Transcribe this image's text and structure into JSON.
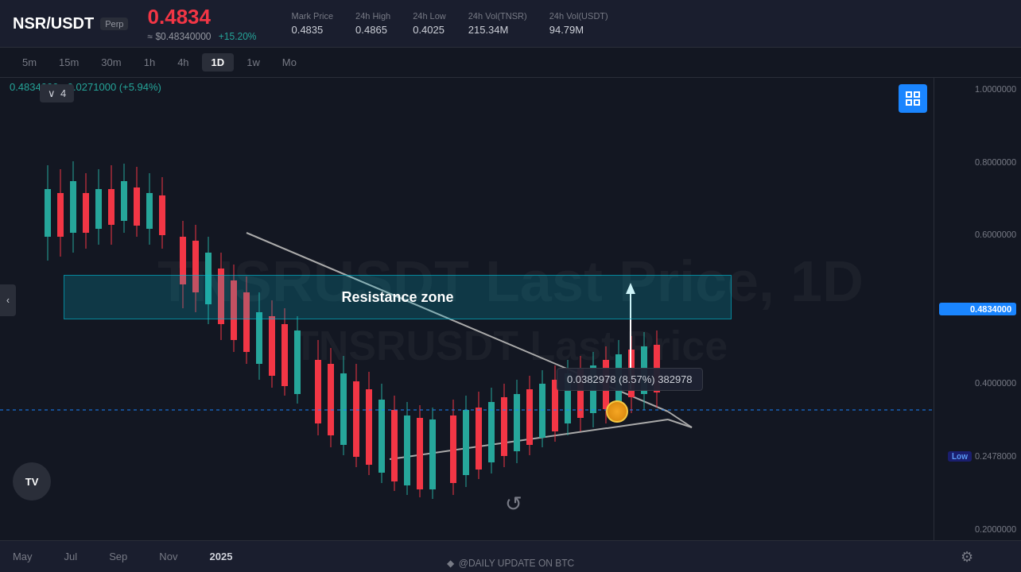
{
  "header": {
    "symbol": "NSR/USDT",
    "perp_label": "Perp",
    "main_price": "0.4834",
    "usd_price": "≈ $0.48340000",
    "change_pct": "+15.20%",
    "stats": [
      {
        "label": "Mark Price",
        "value": "0.4835"
      },
      {
        "label": "24h High",
        "value": "0.4865"
      },
      {
        "label": "24h Low",
        "value": "0.4025"
      },
      {
        "label": "24h Vol(TNSR)",
        "value": "215.34M"
      },
      {
        "label": "24h Vol(USDT)",
        "value": "94.79M"
      }
    ]
  },
  "timeframes": [
    "5m",
    "15m",
    "30m",
    "1h",
    "4h",
    "1D",
    "1w",
    "Mo"
  ],
  "active_timeframe": "1D",
  "chart": {
    "ohlc_display": "0.4834000  +0.0271000 (+5.94%)",
    "watermark_line1": "TNSRUSDT Last Price, 1D",
    "watermark_line2": "TNSRUSDT Last Price",
    "resistance_label": "Resistance zone",
    "tooltip_text": "0.0382978 (8.57%) 382978",
    "current_price_label": "0.4834000",
    "price_labels": [
      "1.0000000",
      "0.8000000",
      "0.6000000",
      "0.4834000",
      "0.4000000",
      "0.2478000",
      "0.2000000"
    ],
    "dropdown_number": "4"
  },
  "bottom": {
    "time_labels": [
      "May",
      "Jul",
      "Sep",
      "Nov",
      "2025"
    ],
    "credit_text": "@DAILY UPDATE ON BTC"
  },
  "icons": {
    "collapse": "⛶",
    "chevron_left": "‹",
    "chevron_down": "∨",
    "settings": "⚙",
    "refresh": "↺",
    "tv_logo": "TV",
    "diamond": "◆"
  }
}
